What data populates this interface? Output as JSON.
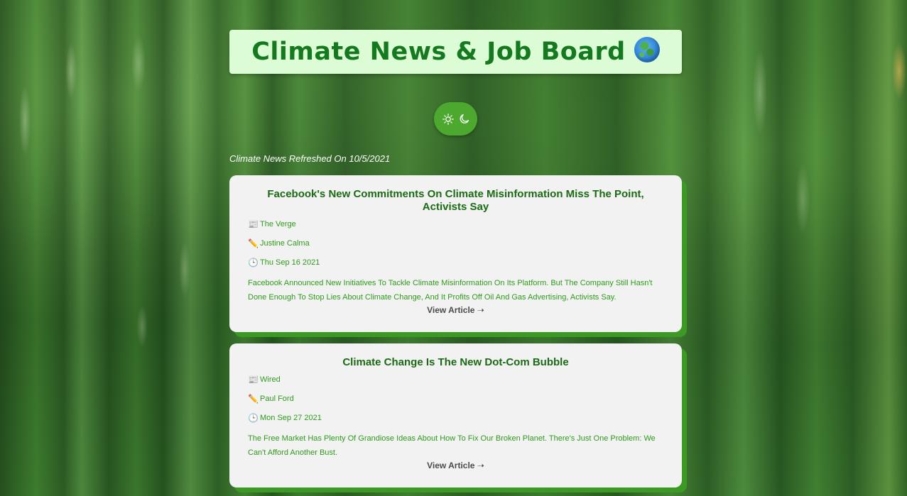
{
  "header": {
    "title": "Climate News & Job Board",
    "title_icon": "globe-asia-icon"
  },
  "theme_toggle": {
    "icons": [
      "sun-icon",
      "moon-icon"
    ]
  },
  "refresh_label": "Climate News Refreshed On 10/5/2021",
  "colors": {
    "accent": "#4ca82f",
    "title_bg": "#dcfcd6",
    "title_text": "#157a1f",
    "card_bg": "#f2f2f2",
    "card_shadow": "#3c9a24",
    "meta_text": "#2f9a1c"
  },
  "articles": [
    {
      "title": "Facebook's New Commitments On Climate Misinformation Miss The Point, Activists Say",
      "source": "The Verge",
      "author": "Justine Calma",
      "date": "Thu Sep 16 2021",
      "description": "Facebook Announced New Initiatives To Tackle Climate Misinformation On Its Platform. But The Company Still Hasn't Done Enough To Stop Lies About Climate Change, And It Profits Off Oil And Gas Advertising, Activists Say.",
      "link_label": "View Article ➝"
    },
    {
      "title": "Climate Change Is The New Dot-Com Bubble",
      "source": "Wired",
      "author": "Paul Ford",
      "date": "Mon Sep 27 2021",
      "description": "The Free Market Has Plenty Of Grandiose Ideas About How To Fix Our Broken Planet. There's Just One Problem: We Can't Afford Another Bust.",
      "link_label": "View Article ➝"
    }
  ]
}
